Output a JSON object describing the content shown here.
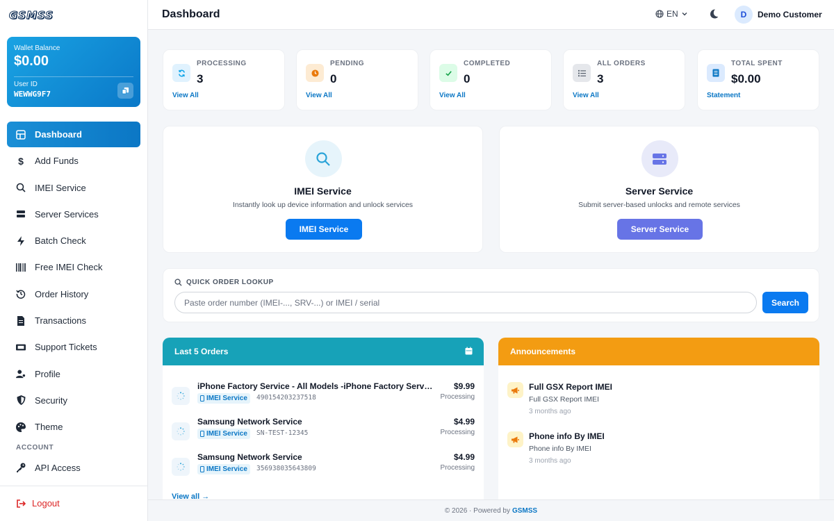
{
  "brand": {
    "logo_text": "GSMSS"
  },
  "wallet": {
    "balance_label": "Wallet Balance",
    "balance": "$0.00",
    "user_id_label": "User ID",
    "user_id": "WEWWG9F7"
  },
  "sidebar": {
    "items": [
      {
        "label": "Dashboard",
        "icon": "dashboard-icon",
        "active": true
      },
      {
        "label": "Add Funds",
        "icon": "dollar-icon"
      },
      {
        "label": "IMEI Service",
        "icon": "search-icon"
      },
      {
        "label": "Server Services",
        "icon": "server-icon"
      },
      {
        "label": "Batch Check",
        "icon": "bolt-icon"
      },
      {
        "label": "Free IMEI Check",
        "icon": "barcode-icon"
      },
      {
        "label": "Order History",
        "icon": "history-icon"
      },
      {
        "label": "Transactions",
        "icon": "file-icon"
      },
      {
        "label": "Support Tickets",
        "icon": "ticket-icon"
      },
      {
        "label": "Profile",
        "icon": "user-cog-icon"
      },
      {
        "label": "Security",
        "icon": "shield-icon"
      },
      {
        "label": "Theme",
        "icon": "palette-icon"
      }
    ],
    "account_section": "ACCOUNT",
    "account_items": [
      {
        "label": "API Access",
        "icon": "key-icon"
      }
    ],
    "logout": "Logout"
  },
  "header": {
    "title": "Dashboard",
    "language": "EN",
    "avatar_initial": "D",
    "user_name": "Demo Customer"
  },
  "stats": [
    {
      "label": "PROCESSING",
      "value": "3",
      "link": "View All",
      "icon": "refresh-icon",
      "color": "#0ea5e9"
    },
    {
      "label": "PENDING",
      "value": "0",
      "link": "View All",
      "icon": "clock-icon",
      "color": "#ea7a0c"
    },
    {
      "label": "COMPLETED",
      "value": "0",
      "link": "View All",
      "icon": "check-icon",
      "color": "#16a34a"
    },
    {
      "label": "ALL ORDERS",
      "value": "3",
      "link": "View All",
      "icon": "list-icon",
      "color": "#4b5563"
    },
    {
      "label": "TOTAL SPENT",
      "value": "$0.00",
      "link": "Statement",
      "icon": "receipt-icon",
      "color": "#0b77c5"
    }
  ],
  "services": {
    "imei": {
      "title": "IMEI Service",
      "desc": "Instantly look up device information and unlock services",
      "button": "IMEI Service",
      "color": "#0a7af0"
    },
    "server": {
      "title": "Server Service",
      "desc": "Submit server-based unlocks and remote services",
      "button": "Server Service",
      "color": "#6774e6"
    }
  },
  "lookup": {
    "heading": "QUICK ORDER LOOKUP",
    "placeholder": "Paste order number (IMEI-..., SRV-...) or IMEI / serial",
    "button": "Search"
  },
  "orders": {
    "title": "Last 5 Orders",
    "rows": [
      {
        "name": "iPhone Factory Service - All Models -iPhone Factory Service - All Models",
        "tag": "IMEI Service",
        "imei": "490154203237518",
        "price": "$9.99",
        "status": "Processing"
      },
      {
        "name": "Samsung Network Service",
        "tag": "IMEI Service",
        "imei": "SN-TEST-12345",
        "price": "$4.99",
        "status": "Processing"
      },
      {
        "name": "Samsung Network Service",
        "tag": "IMEI Service",
        "imei": "356938035643809",
        "price": "$4.99",
        "status": "Processing"
      }
    ],
    "view_all": "View all →"
  },
  "announcements": {
    "title": "Announcements",
    "items": [
      {
        "title": "Full GSX Report IMEI",
        "desc": "Full GSX Report IMEI",
        "when": "3 months ago"
      },
      {
        "title": "Phone info By IMEI",
        "desc": "Phone info By IMEI",
        "when": "3 months ago"
      }
    ]
  },
  "footer": {
    "text": "© 2026 · Powered by",
    "brand": "GSMSS"
  }
}
